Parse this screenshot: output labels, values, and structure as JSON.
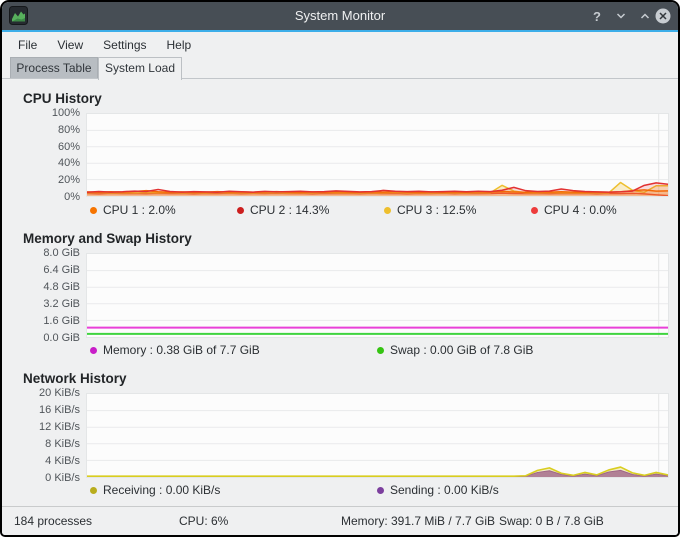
{
  "window": {
    "title": "System Monitor",
    "controls": [
      {
        "id": "help-button",
        "icon": "question-mark-icon",
        "glyph": "?"
      },
      {
        "id": "minimize-button",
        "icon": "chevron-down-icon"
      },
      {
        "id": "maximize-button",
        "icon": "chevron-up-icon"
      },
      {
        "id": "close-button",
        "icon": "close-icon"
      }
    ]
  },
  "menu": {
    "items": [
      "File",
      "View",
      "Settings",
      "Help"
    ]
  },
  "tabs": [
    {
      "label": "Process Table",
      "active": false
    },
    {
      "label": "System Load",
      "active": true
    }
  ],
  "colors": {
    "accent": "#3daee9",
    "titlebar": "#474e55",
    "cpu1": "#f67400",
    "cpu2": "#cc1f1f",
    "cpu3": "#eebf2e",
    "cpu4": "#ed3c3c",
    "memory": "#e93fd8",
    "swap": "#3fd43f",
    "receiving": "#d9cd20",
    "sending": "#8e44ad"
  },
  "chart_data": [
    {
      "type": "line",
      "title": "CPU History",
      "ylabel": "",
      "xlabel": "",
      "ylim": [
        0,
        100
      ],
      "ymax": 100,
      "grid": true,
      "yticks": [
        "100%",
        "80%",
        "60%",
        "40%",
        "20%",
        "0%"
      ],
      "legend": [
        {
          "label": "CPU 1 : 2.0%",
          "color": "#f67400"
        },
        {
          "label": "CPU 2 : 14.3%",
          "color": "#cc1f1f"
        },
        {
          "label": "CPU 3 : 12.5%",
          "color": "#eebf2e"
        },
        {
          "label": "CPU 4 : 0.0%",
          "color": "#ed3c3c"
        }
      ],
      "series": [
        {
          "name": "CPU 4",
          "color": "#ed3c3c",
          "width": 1.4,
          "fill": 0,
          "values": [
            3,
            2.6,
            3.2,
            2.8,
            3,
            2.7,
            3.1,
            2.8,
            3,
            2.6,
            3,
            2.8,
            3.1,
            2.7,
            3,
            2.8,
            3.2,
            2.8,
            3,
            2.6,
            3,
            2.8,
            3,
            2.7,
            3.1,
            2.8,
            3,
            2.6,
            3,
            2.8,
            3.1,
            2.7,
            3,
            2.8,
            3,
            3.4,
            3,
            2.8,
            3,
            2.7,
            3,
            2.8,
            3,
            2.6,
            3,
            2.8,
            3.2,
            2.6,
            1.5,
            0.5
          ]
        },
        {
          "name": "CPU 3",
          "color": "#eebf2e",
          "width": 1.5,
          "fill": 0.25,
          "values": [
            3.8,
            4.2,
            3.6,
            4,
            3.7,
            4.1,
            3.8,
            4.3,
            3.7,
            4,
            3.6,
            4.2,
            3.8,
            4,
            3.6,
            4.1,
            3.9,
            3.6,
            4,
            3.7,
            4.2,
            3.8,
            4,
            3.6,
            4,
            3.8,
            4.2,
            3.7,
            4,
            3.6,
            4,
            3.8,
            3.6,
            4.1,
            3.8,
            13,
            6,
            4,
            3.8,
            4.2,
            3.8,
            4,
            3.7,
            4,
            3.8,
            16.5,
            7,
            4.5,
            12.5,
            12.5
          ]
        },
        {
          "name": "CPU 1",
          "color": "#f67400",
          "width": 1.5,
          "fill": 0.22,
          "values": [
            5,
            4.6,
            5.2,
            4.8,
            5.5,
            6.5,
            5.2,
            4.6,
            5,
            4.4,
            4.8,
            5.3,
            4.7,
            5.1,
            4.5,
            5,
            5.4,
            4.8,
            4.4,
            5,
            4.6,
            5.2,
            4.8,
            4.5,
            5.1,
            4.7,
            5.3,
            4.8,
            4.4,
            5,
            4.6,
            4.9,
            4.5,
            5.2,
            4.8,
            5.5,
            4.9,
            4.5,
            5,
            4.7,
            5.2,
            4.8,
            4.4,
            4.9,
            4.6,
            5.1,
            6.5,
            7.5,
            6,
            6.2
          ]
        },
        {
          "name": "CPU 2",
          "color": "#e23131",
          "width": 1.5,
          "fill": 0.15,
          "values": [
            4.5,
            5.5,
            4.8,
            5.2,
            6,
            5.5,
            8,
            5.5,
            4.8,
            5.4,
            5,
            4.6,
            5.8,
            5.2,
            4.8,
            5.6,
            5,
            5.3,
            5.8,
            5,
            5.4,
            6.2,
            5.6,
            5,
            5.3,
            6.8,
            5.8,
            5.4,
            5.8,
            5,
            5.4,
            5.8,
            5.2,
            5.8,
            5.4,
            7,
            10.5,
            6.5,
            5.5,
            6,
            8.5,
            6.5,
            5.5,
            5,
            4.8,
            5.2,
            6,
            13,
            16,
            14.3
          ]
        }
      ]
    },
    {
      "type": "line",
      "title": "Memory and Swap History",
      "ylabel": "",
      "xlabel": "",
      "ylim": [
        0,
        8
      ],
      "ymax": 8,
      "grid": true,
      "yticks": [
        "8.0 GiB",
        "6.4 GiB",
        "4.8 GiB",
        "3.2 GiB",
        "1.6 GiB",
        "0.0 GiB"
      ],
      "legend": [
        {
          "label": "Memory : 0.38 GiB of 7.7 GiB",
          "color": "#c81ec8"
        },
        {
          "label": "Swap : 0.00 GiB of 7.8 GiB",
          "color": "#35c412"
        }
      ],
      "series": [
        {
          "name": "Swap",
          "color": "#3fd43f",
          "width": 2,
          "fill": 0,
          "values": [
            0.3,
            0.3
          ]
        },
        {
          "name": "Memory",
          "color": "#e93fd8",
          "width": 2,
          "fill": 0,
          "values": [
            0.9,
            0.9
          ]
        }
      ]
    },
    {
      "type": "line",
      "title": "Network History",
      "ylabel": "",
      "xlabel": "",
      "ylim": [
        0,
        20
      ],
      "ymax": 20,
      "grid": true,
      "yticks": [
        "20 KiB/s",
        "16 KiB/s",
        "12 KiB/s",
        "8 KiB/s",
        "4 KiB/s",
        "0 KiB/s"
      ],
      "legend": [
        {
          "label": "Receiving : 0.00 KiB/s",
          "color": "#b9ad1d"
        },
        {
          "label": "Sending : 0.00 KiB/s",
          "color": "#7c3f9e"
        }
      ],
      "series": [
        {
          "name": "Sending",
          "color": "#8e44ad",
          "width": 1,
          "fill": 0.8,
          "values": [
            0.05,
            0.05,
            0.05,
            0.05,
            0.05,
            0.05,
            0.05,
            0.05,
            0.05,
            0.05,
            0.05,
            0.05,
            0.05,
            0.05,
            0.05,
            0.05,
            0.05,
            0.05,
            0.05,
            0.05,
            0.05,
            0.05,
            0.05,
            0.05,
            0.05,
            0.05,
            0.05,
            0.05,
            0.05,
            0.05,
            0.05,
            0.05,
            0.05,
            0.05,
            0.05,
            0.05,
            0.05,
            0.2,
            1.1,
            1.5,
            0.6,
            0.2,
            0.7,
            0.3,
            1.2,
            1.6,
            0.6,
            0.2,
            0.7,
            0.3
          ]
        },
        {
          "name": "Receiving",
          "color": "#d9cd20",
          "width": 1.6,
          "fill": 0.25,
          "values": [
            0.2,
            0.2,
            0.2,
            0.2,
            0.2,
            0.2,
            0.2,
            0.2,
            0.2,
            0.2,
            0.2,
            0.2,
            0.2,
            0.2,
            0.2,
            0.2,
            0.2,
            0.2,
            0.2,
            0.2,
            0.2,
            0.2,
            0.2,
            0.2,
            0.2,
            0.2,
            0.2,
            0.2,
            0.2,
            0.2,
            0.2,
            0.2,
            0.2,
            0.2,
            0.2,
            0.2,
            0.2,
            0.3,
            1.6,
            2.2,
            0.9,
            0.4,
            1.1,
            0.5,
            1.7,
            2.4,
            1.0,
            0.4,
            1.1,
            0.5
          ]
        }
      ]
    }
  ],
  "status_bar": {
    "processes": "184 processes",
    "cpu": "CPU: 6%",
    "memory": "Memory: 391.7 MiB / 7.7 GiB",
    "swap": "Swap: 0 B / 7.8 GiB"
  }
}
